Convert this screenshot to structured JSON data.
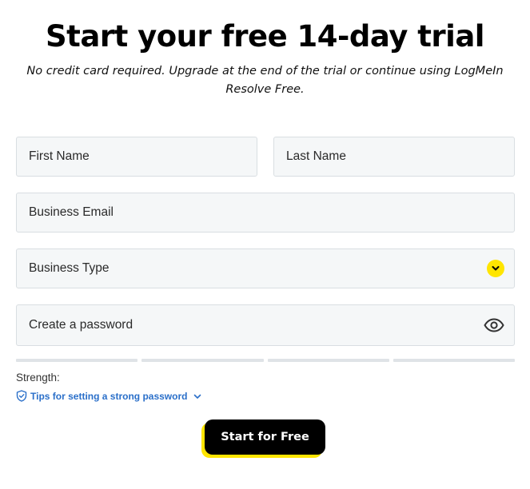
{
  "header": {
    "title": "Start your free 14-day trial",
    "subtitle": "No credit card required. Upgrade at the end of the trial or continue using LogMeIn Resolve Free."
  },
  "form": {
    "first_name": {
      "placeholder": "First Name",
      "value": ""
    },
    "last_name": {
      "placeholder": "Last Name",
      "value": ""
    },
    "email": {
      "placeholder": "Business Email",
      "value": ""
    },
    "business_type": {
      "selected": "Business Type",
      "icon": "chevron-down-icon"
    },
    "password": {
      "placeholder": "Create a password",
      "value": "",
      "icon": "eye-icon"
    },
    "strength": {
      "label": "Strength:",
      "bars_filled": 0,
      "bars_total": 4
    },
    "tips": {
      "label": "Tips for setting a strong password",
      "icon": "shield-check-icon"
    },
    "submit_label": "Start for Free"
  },
  "colors": {
    "accent_yellow": "#ffe500",
    "link_blue": "#2a6fc9",
    "field_bg": "#f5f7f8",
    "button_bg": "#000000"
  }
}
